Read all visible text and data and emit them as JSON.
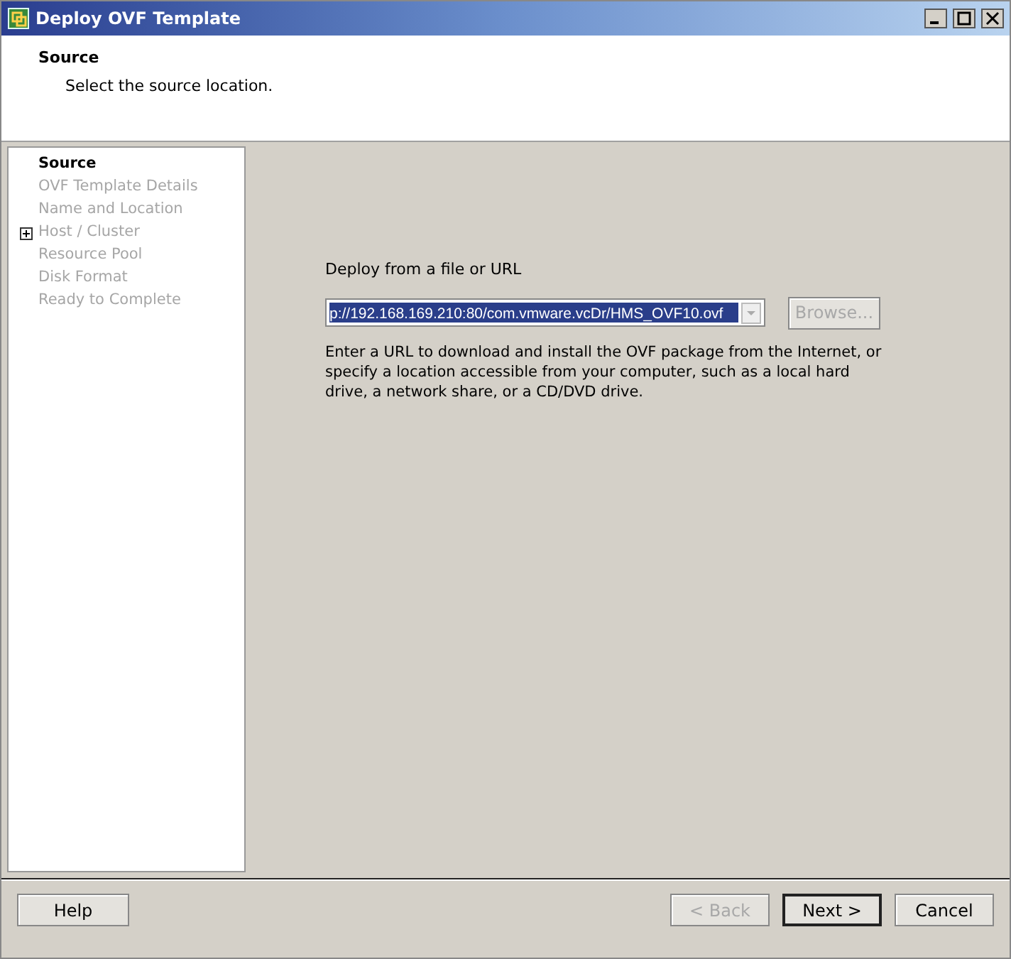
{
  "window": {
    "title": "Deploy OVF Template"
  },
  "header": {
    "title": "Source",
    "subtitle": "Select the source location."
  },
  "steps": [
    {
      "label": "Source",
      "selected": true,
      "expandable": false
    },
    {
      "label": "OVF Template Details",
      "selected": false,
      "expandable": false
    },
    {
      "label": "Name and Location",
      "selected": false,
      "expandable": false
    },
    {
      "label": "Host / Cluster",
      "selected": false,
      "expandable": true
    },
    {
      "label": "Resource Pool",
      "selected": false,
      "expandable": false
    },
    {
      "label": "Disk Format",
      "selected": false,
      "expandable": false
    },
    {
      "label": "Ready to Complete",
      "selected": false,
      "expandable": false
    }
  ],
  "source": {
    "label": "Deploy from a file or URL",
    "value": "p://192.168.169.210:80/com.vmware.vcDr/HMS_OVF10.ovf",
    "browse": {
      "label": "Browse...",
      "disabled": true
    },
    "help": "Enter a URL to download and install the OVF package from the Internet, or specify a location accessible from your computer, such as a local hard drive, a network share, or a CD/DVD drive."
  },
  "buttons": [
    {
      "label": "Help",
      "disabled": false,
      "default": false
    },
    {
      "label": "< Back",
      "disabled": true,
      "default": false
    },
    {
      "label": "Next >",
      "disabled": false,
      "default": true
    },
    {
      "label": "Cancel",
      "disabled": false,
      "default": false
    }
  ]
}
